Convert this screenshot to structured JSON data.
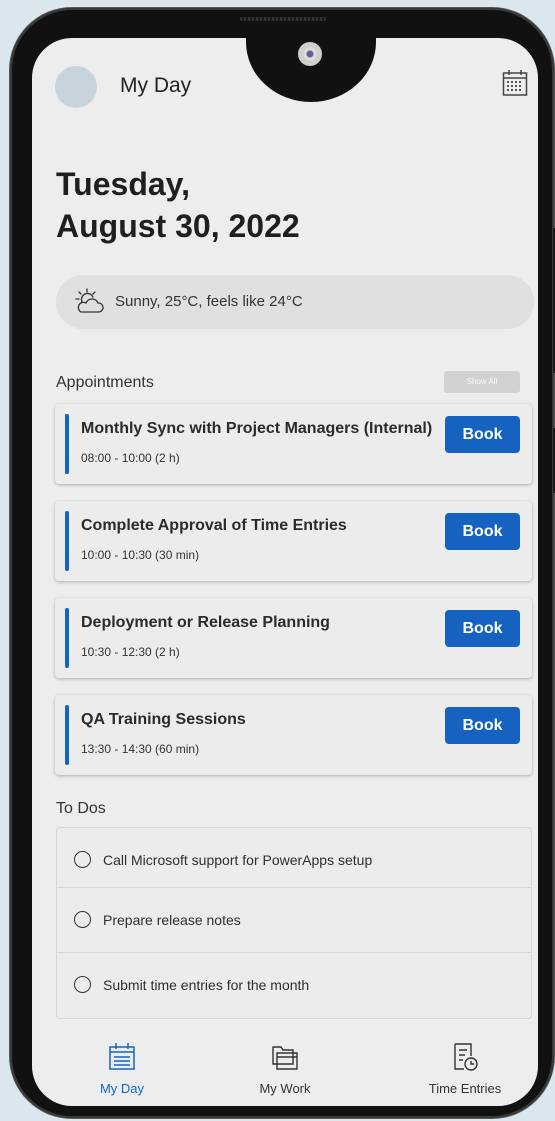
{
  "header": {
    "title": "My Day",
    "calendar_icon": "calendar-icon"
  },
  "date": {
    "line1": "Tuesday,",
    "line2": "August 30, 2022"
  },
  "weather": {
    "icon": "partly-sunny-icon",
    "text": "Sunny, 25°C, feels like 24°C"
  },
  "appointments": {
    "label": "Appointments",
    "show_all": "Show All",
    "items": [
      {
        "title": "Monthly Sync with Project Managers (Internal)",
        "time": "08:00 - 10:00 (2 h)",
        "button": "Book"
      },
      {
        "title": "Complete Approval of Time Entries",
        "time": "10:00 - 10:30 (30 min)",
        "button": "Book"
      },
      {
        "title": "Deployment or Release Planning",
        "time": "10:30 - 12:30 (2 h)",
        "button": "Book"
      },
      {
        "title": "QA Training Sessions",
        "time": "13:30 - 14:30 (60 min)",
        "button": "Book"
      }
    ]
  },
  "todos": {
    "label": "To Dos",
    "items": [
      {
        "text": "Call Microsoft support for PowerApps setup"
      },
      {
        "text": "Prepare release notes"
      },
      {
        "text": "Submit time entries for the month"
      }
    ]
  },
  "nav": {
    "items": [
      {
        "label": "My Day",
        "icon": "calendar-icon",
        "active": true
      },
      {
        "label": "My Work",
        "icon": "folders-icon",
        "active": false
      },
      {
        "label": "Time Entries",
        "icon": "time-entries-icon",
        "active": false
      }
    ]
  },
  "colors": {
    "accent": "#1565c0",
    "background": "#ededed"
  }
}
